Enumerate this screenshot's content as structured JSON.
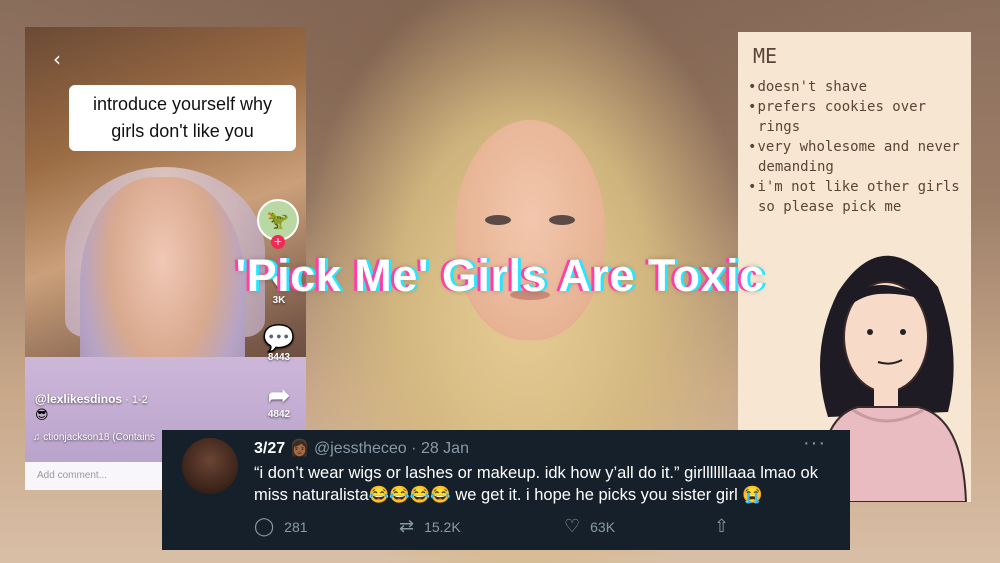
{
  "title": "'Pick Me' Girls Are Toxic",
  "tiktok": {
    "caption": "introduce yourself why girls don't like you",
    "username": "@lexlikesdinos",
    "age": "· 1-2",
    "sound": "ctionjackson18 (Contains",
    "comment_placeholder": "Add comment...",
    "likes": "3K",
    "comments": "8443",
    "shares": "4842",
    "emoji": "😎",
    "back_icon": "chevron-left-icon",
    "avatar_icon": "dinosaur-icon"
  },
  "me_card": {
    "heading": "ME",
    "items": [
      "doesn't shave",
      "prefers cookies over rings",
      "very wholesome and never demanding",
      "i'm not like other girls so please pick me"
    ]
  },
  "tweet": {
    "name": "3/27",
    "name_emoji": "👩🏾",
    "handle": "@jesstheceo",
    "separator": "·",
    "date": "28 Jan",
    "more": "···",
    "text": "“i don’t wear wigs or lashes or makeup. idk how y’all do it.” girlllllllaaa lmao ok miss naturalista😂😂😂😂 we get it. i hope he picks you sister girl 😭",
    "replies": "281",
    "retweets": "15.2K",
    "likes": "63K"
  },
  "colors": {
    "tweet_bg": "#15202b",
    "tweet_muted": "#8899a6",
    "title_glitch_pink": "#ff3fa4",
    "title_glitch_cyan": "#28e6ff",
    "me_card_bg": "#f6e6d2"
  }
}
